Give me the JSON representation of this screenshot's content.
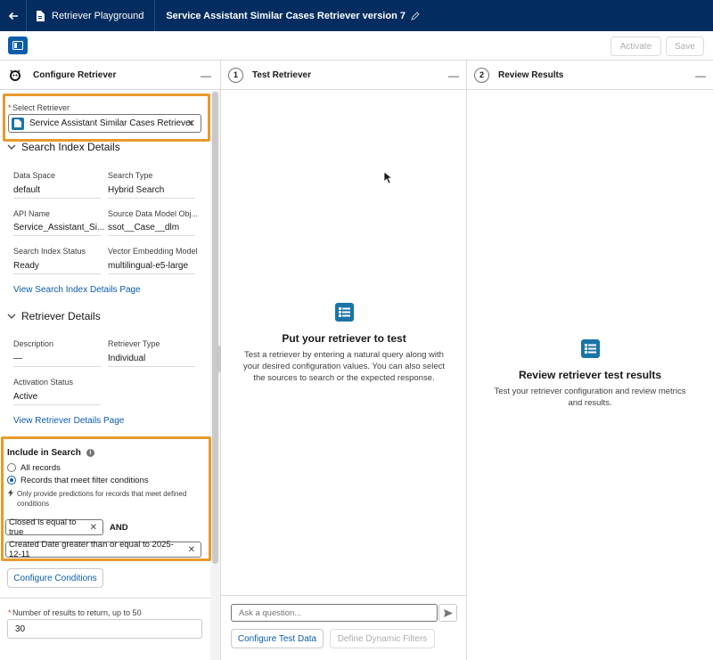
{
  "topbar": {
    "app_tab": "Retriever Playground",
    "record_tab": "Service Assistant Similar Cases Retriever version 7"
  },
  "toolbar": {
    "activate_label": "Activate",
    "save_label": "Save"
  },
  "configure": {
    "title": "Configure Retriever",
    "select_label": "Select Retriever",
    "required_mark": "*",
    "selected_retriever": "Service Assistant Similar Cases Retriever",
    "index_section": "Search Index Details",
    "fields": {
      "data_space_label": "Data Space",
      "data_space_value": "default",
      "search_type_label": "Search Type",
      "search_type_value": "Hybrid Search",
      "api_name_label": "API Name",
      "api_name_value": "Service_Assistant_Si...",
      "source_dmo_label": "Source Data Model Obj...",
      "source_dmo_value": "ssot__Case__dlm",
      "index_status_label": "Search Index Status",
      "index_status_value": "Ready",
      "embedding_label": "Vector Embedding Model",
      "embedding_value": "multilingual-e5-large"
    },
    "index_link": "View Search Index Details Page",
    "retriever_section": "Retriever Details",
    "retriever": {
      "description_label": "Description",
      "description_value": "—",
      "type_label": "Retriever Type",
      "type_value": "Individual",
      "activation_label": "Activation Status",
      "activation_value": "Active"
    },
    "retriever_link": "View Retriever Details Page",
    "include": {
      "title": "Include in Search",
      "option_all": "All records",
      "option_filter": "Records that meet filter conditions",
      "hint": "Only provide predictions for records that meet defined conditions",
      "condition1": "Closed is equal to true",
      "and_label": "AND",
      "condition2": "Created Date greater than or equal to 2025-12-11"
    },
    "configure_conditions": "Configure Conditions",
    "results_label": "Number of results to return, up to 50",
    "results_value": "30"
  },
  "test": {
    "step": "1",
    "title": "Test Retriever",
    "empty_title": "Put your retriever to test",
    "empty_body": "Test a retriever by entering a natural query along with your desired configuration values. You can also select the sources to search or the expected response.",
    "ask_placeholder": "Ask a question...",
    "configure_test_data": "Configure Test Data",
    "define_filters": "Define Dynamic Filters"
  },
  "review": {
    "step": "2",
    "title": "Review Results",
    "empty_title": "Review retriever test results",
    "empty_body": "Test your retriever configuration and review metrics and results."
  },
  "colors": {
    "nav": "#032d60",
    "brand": "#0b5cab",
    "highlight": "#e8992b"
  }
}
